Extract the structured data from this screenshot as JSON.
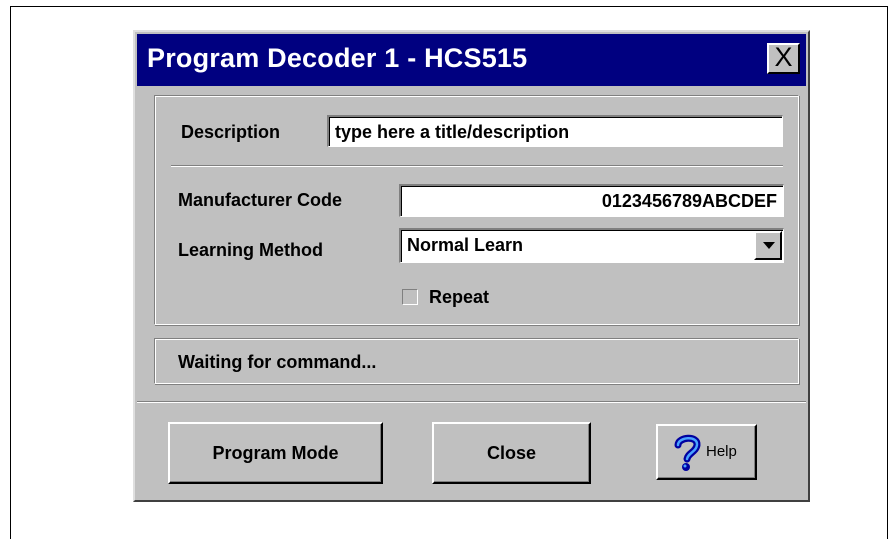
{
  "window": {
    "title": "Program Decoder 1 - HCS515",
    "close_glyph": "X"
  },
  "form": {
    "description_label": "Description",
    "description_value": "type here a title/description",
    "manufacturer_code_label": "Manufacturer Code",
    "manufacturer_code_value": "0123456789ABCDEF",
    "learning_method_label": "Learning Method",
    "learning_method_value": "Normal Learn",
    "repeat_label": "Repeat",
    "repeat_checked": false
  },
  "status": {
    "text": "Waiting for command..."
  },
  "buttons": {
    "program_mode": "Program Mode",
    "close": "Close",
    "help": "Help",
    "help_icon": "question-mark-icon"
  },
  "colors": {
    "titlebar": "#000080",
    "dialog_face": "#c0c0c0"
  }
}
